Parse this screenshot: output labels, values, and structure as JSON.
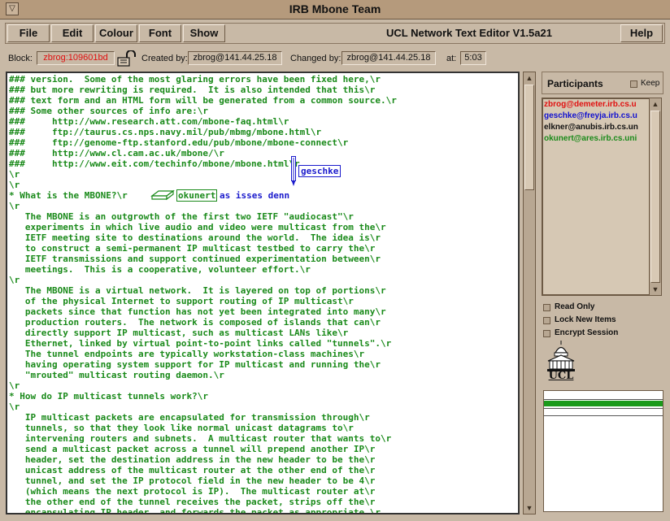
{
  "window": {
    "title": "IRB Mbone Team",
    "menu_button": "▽"
  },
  "menu": {
    "items": [
      "File",
      "Edit",
      "Colour",
      "Font",
      "Show"
    ],
    "app_title": "UCL Network Text Editor V1.5a21",
    "help": "Help"
  },
  "info": {
    "block_label": "Block:",
    "block_value": "zbrog:109601bd",
    "created_label": "Created by:",
    "created_value": "zbrog@141.44.25.18",
    "changed_label": "Changed by:",
    "changed_value": "zbrog@141.44.25.18",
    "at_label": "at:",
    "at_value": "5:03"
  },
  "editor": {
    "lines": [
      "### version.  Some of the most glaring errors have been fixed here,\\r",
      "### but more rewriting is required.  It is also intended that this\\r",
      "### text form and an HTML form will be generated from a common source.\\r",
      "### Some other sources of info are:\\r",
      "###     http://www.research.att.com/mbone-faq.html\\r",
      "###     ftp://taurus.cs.nps.navy.mil/pub/mbmg/mbone.html\\r",
      "###     ftp://genome-ftp.stanford.edu/pub/mbone/mbone-connect\\r",
      "###     http://www.cl.cam.ac.uk/mbone/\\r",
      "###     http://www.eit.com/techinfo/mbone/mbone.html\\r",
      "\\r",
      "\\r",
      "* What is the MBONE?\\r",
      "\\r",
      "   The MBONE is an outgrowth of the first two IETF \"audiocast\"\\r",
      "   experiments in which live audio and video were multicast from the\\r",
      "   IETF meeting site to destinations around the world.  The idea is\\r",
      "   to construct a semi-permanent IP multicast testbed to carry the\\r",
      "   IETF transmissions and support continued experimentation between\\r",
      "   meetings.  This is a cooperative, volunteer effort.\\r",
      "\\r",
      "   The MBONE is a virtual network.  It is layered on top of portions\\r",
      "   of the physical Internet to support routing of IP multicast\\r",
      "   packets since that function has not yet been integrated into many\\r",
      "   production routers.  The network is composed of islands that can\\r",
      "   directly support IP multicast, such as multicast LANs like\\r",
      "   Ethernet, linked by virtual point-to-point links called \"tunnels\".\\r",
      "   The tunnel endpoints are typically workstation-class machines\\r",
      "   having operating system support for IP multicast and running the\\r",
      "   \"mrouted\" multicast routing daemon.\\r",
      "\\r",
      "* How do IP multicast tunnels work?\\r",
      "\\r",
      "   IP multicast packets are encapsulated for transmission through\\r",
      "   tunnels, so that they look like normal unicast datagrams to\\r",
      "   intervening routers and subnets.  A multicast router that wants to\\r",
      "   send a multicast packet across a tunnel will prepend another IP\\r",
      "   header, set the destination address in the new header to be the\\r",
      "   unicast address of the multicast router at the other end of the\\r",
      "   tunnel, and set the IP protocol field in the new header to be 4\\r",
      "   (which means the next protocol is IP).  The multicast router at\\r",
      "   the other end of the tunnel receives the packet, strips off the\\r",
      "   encapsulating IP header, and forwards the packet as appropriate.\\r"
    ],
    "cursor_user": "geschke",
    "remote_user": "okunert",
    "remote_text": "as isses denn"
  },
  "participants": {
    "title": "Participants",
    "keep": "Keep",
    "users": [
      {
        "name": "zbrog@demeter.irb.cs.u",
        "color": "#e01010"
      },
      {
        "name": "geschke@freyja.irb.cs.u",
        "color": "#1010d0"
      },
      {
        "name": "elkner@anubis.irb.cs.un",
        "color": "#111111"
      },
      {
        "name": "okunert@ares.irb.cs.uni",
        "color": "#1a8a1a"
      }
    ]
  },
  "options": {
    "read_only": "Read Only",
    "lock_new_items": "Lock New Items",
    "encrypt_session": "Encrypt Session"
  },
  "logo": {
    "text": "UCL"
  },
  "colors": {
    "text": "#1a8a1a",
    "cursor": "#1a1acc",
    "meter": "#1a9a1a"
  }
}
